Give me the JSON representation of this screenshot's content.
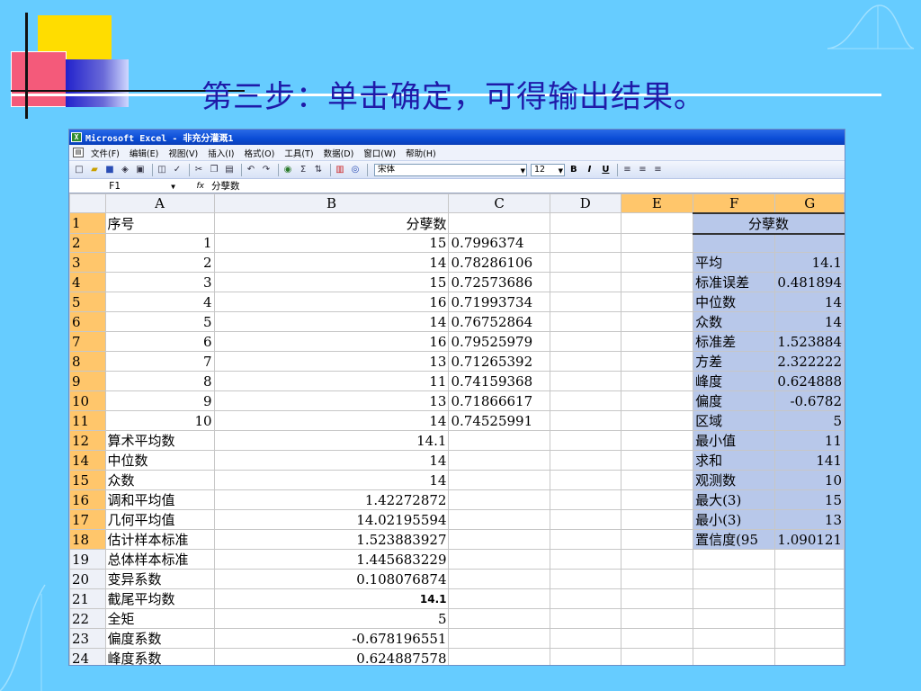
{
  "slide_title": "第三步：单击确定，可得输出结果。",
  "window": {
    "title": "Microsoft Excel - 非充分灌溉1",
    "menu": [
      "文件(F)",
      "编辑(E)",
      "视图(V)",
      "插入(I)",
      "格式(O)",
      "工具(T)",
      "数据(D)",
      "窗口(W)",
      "帮助(H)"
    ],
    "font_name": "宋体",
    "font_size": "12",
    "format_buttons": [
      "B",
      "I",
      "U"
    ]
  },
  "formula_bar": {
    "cell_ref": "F1",
    "fx": "fx",
    "content": "分孽数"
  },
  "columns": [
    "A",
    "B",
    "C",
    "D",
    "E",
    "F",
    "G"
  ],
  "rows": [
    {
      "n": "1",
      "a": "序号",
      "b": "分孽数",
      "c": "",
      "f": "分孽数",
      "g": ""
    },
    {
      "n": "2",
      "a": "1",
      "b": "15",
      "c": "0.7996374",
      "f": "",
      "g": ""
    },
    {
      "n": "3",
      "a": "2",
      "b": "14",
      "c": "0.78286106",
      "f": "平均",
      "g": "14.1"
    },
    {
      "n": "4",
      "a": "3",
      "b": "15",
      "c": "0.72573686",
      "f": "标准误差",
      "g": "0.481894"
    },
    {
      "n": "5",
      "a": "4",
      "b": "16",
      "c": "0.71993734",
      "f": "中位数",
      "g": "14"
    },
    {
      "n": "6",
      "a": "5",
      "b": "14",
      "c": "0.76752864",
      "f": "众数",
      "g": "14"
    },
    {
      "n": "7",
      "a": "6",
      "b": "16",
      "c": "0.79525979",
      "f": "标准差",
      "g": "1.523884"
    },
    {
      "n": "8",
      "a": "7",
      "b": "13",
      "c": "0.71265392",
      "f": "方差",
      "g": "2.322222"
    },
    {
      "n": "9",
      "a": "8",
      "b": "11",
      "c": "0.74159368",
      "f": "峰度",
      "g": "0.624888"
    },
    {
      "n": "10",
      "a": "9",
      "b": "13",
      "c": "0.71866617",
      "f": "偏度",
      "g": "-0.6782"
    },
    {
      "n": "11",
      "a": "10",
      "b": "14",
      "c": "0.74525991",
      "f": "区域",
      "g": "5"
    },
    {
      "n": "12",
      "a": "算术平均数",
      "b": "14.1",
      "c": "",
      "f": "最小值",
      "g": "11"
    },
    {
      "n": "14",
      "a": "中位数",
      "b": "14",
      "c": "",
      "f": "求和",
      "g": "141"
    },
    {
      "n": "15",
      "a": "众数",
      "b": "14",
      "c": "",
      "f": "观测数",
      "g": "10"
    },
    {
      "n": "16",
      "a": "调和平均值",
      "b": "1.42272872",
      "c": "",
      "f": "最大(3)",
      "g": "15"
    },
    {
      "n": "17",
      "a": "几何平均值",
      "b": "14.02195594",
      "c": "",
      "f": "最小(3)",
      "g": "13"
    },
    {
      "n": "18",
      "a": "估计样本标准",
      "b": "1.523883927",
      "c": "",
      "f": "置信度(95",
      "g": "1.090121"
    },
    {
      "n": "19",
      "a": "总体样本标准",
      "b": "1.445683229",
      "c": "",
      "f": "",
      "g": ""
    },
    {
      "n": "20",
      "a": "变异系数",
      "b": "0.108076874",
      "c": "",
      "f": "",
      "g": ""
    },
    {
      "n": "21",
      "a": "截尾平均数",
      "b": "14.1",
      "c": "",
      "f": "",
      "g": ""
    },
    {
      "n": "22",
      "a": "全矩",
      "b": "5",
      "c": "",
      "f": "",
      "g": ""
    },
    {
      "n": "23",
      "a": "偏度系数",
      "b": "-0.678196551",
      "c": "",
      "f": "",
      "g": ""
    },
    {
      "n": "24",
      "a": "峰度系数",
      "b": "0.624887578",
      "c": "",
      "f": "",
      "g": ""
    }
  ]
}
